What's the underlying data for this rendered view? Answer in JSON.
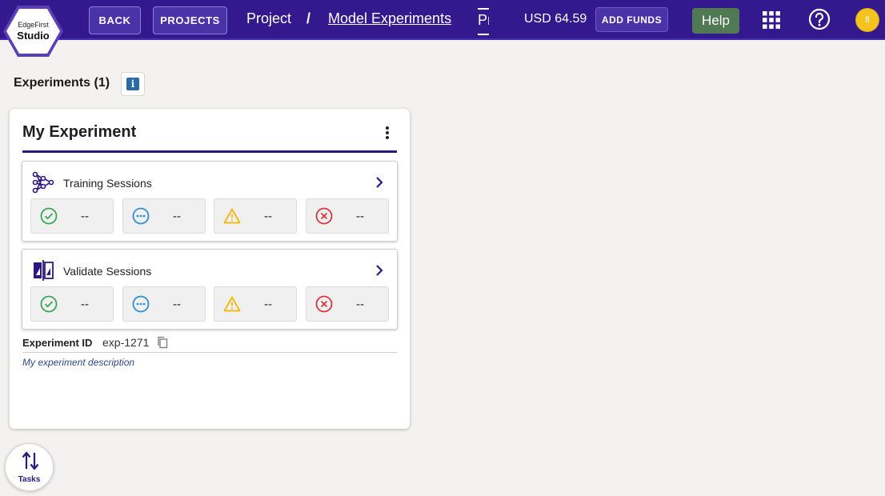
{
  "logo": {
    "top": "EdgeFirst",
    "bottom": "Studio"
  },
  "header": {
    "back_label": "BACK",
    "projects_label": "PROJECTS",
    "breadcrumb_root": "Project",
    "breadcrumb_sep": "/",
    "breadcrumb_current": "Model Experiments",
    "breadcrumb_overflow": "Pr",
    "balance": "USD 64.59",
    "add_funds_label": "ADD FUNDS",
    "help_label": "Help",
    "avatar_initial": "fl"
  },
  "page": {
    "title": "Experiments (1)",
    "info_glyph": "i"
  },
  "experiment": {
    "name": "My Experiment",
    "sections": [
      {
        "label": "Training Sessions",
        "icon": "network-icon",
        "stats": [
          {
            "kind": "success",
            "value": "--"
          },
          {
            "kind": "running",
            "value": "--"
          },
          {
            "kind": "warning",
            "value": "--"
          },
          {
            "kind": "error",
            "value": "--"
          }
        ]
      },
      {
        "label": "Validate Sessions",
        "icon": "validate-icon",
        "stats": [
          {
            "kind": "success",
            "value": "--"
          },
          {
            "kind": "running",
            "value": "--"
          },
          {
            "kind": "warning",
            "value": "--"
          },
          {
            "kind": "error",
            "value": "--"
          }
        ]
      }
    ],
    "id_label": "Experiment ID",
    "id_value": "exp-1271",
    "description": "My experiment description"
  },
  "tasks": {
    "label": "Tasks"
  },
  "colors": {
    "header_bg": "#33198d",
    "accent": "#2c1880",
    "success": "#3aa655",
    "running": "#2f8fd6",
    "warning": "#f2b705",
    "error": "#d9363e",
    "help_bg": "#4f7a54",
    "avatar_bg": "#f3c421"
  }
}
